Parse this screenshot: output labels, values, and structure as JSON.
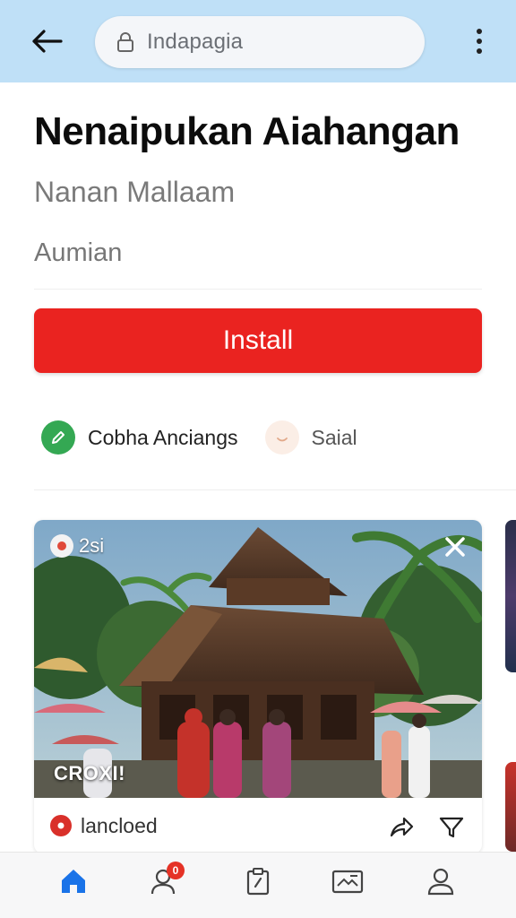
{
  "browser": {
    "url_text": "Indapagia",
    "icons": {
      "back": "arrow-left-icon",
      "lock": "lock-icon",
      "menu": "more-vertical-icon"
    }
  },
  "app": {
    "title": "Nenaipukan Aiahangan",
    "developer": "Nanan Mallaam",
    "category": "Aumian",
    "install_label": "Install",
    "accent_color": "#ea2320"
  },
  "chips": [
    {
      "label": "Cobha Anciangs",
      "icon": "pencil-icon"
    },
    {
      "label": "Saial",
      "icon": "smile-icon"
    }
  ],
  "card": {
    "badge_text": "2si",
    "caption": "CROXI!",
    "source_label": "lancloed",
    "icons": {
      "close": "close-icon",
      "share": "share-icon",
      "filter": "filter-icon"
    }
  },
  "bottom_nav": {
    "items": [
      {
        "name": "home",
        "icon": "home-icon",
        "active": true
      },
      {
        "name": "people",
        "icon": "people-icon",
        "badge": "0"
      },
      {
        "name": "clipboard",
        "icon": "clipboard-icon"
      },
      {
        "name": "media",
        "icon": "media-icon"
      },
      {
        "name": "profile",
        "icon": "profile-icon"
      }
    ]
  }
}
